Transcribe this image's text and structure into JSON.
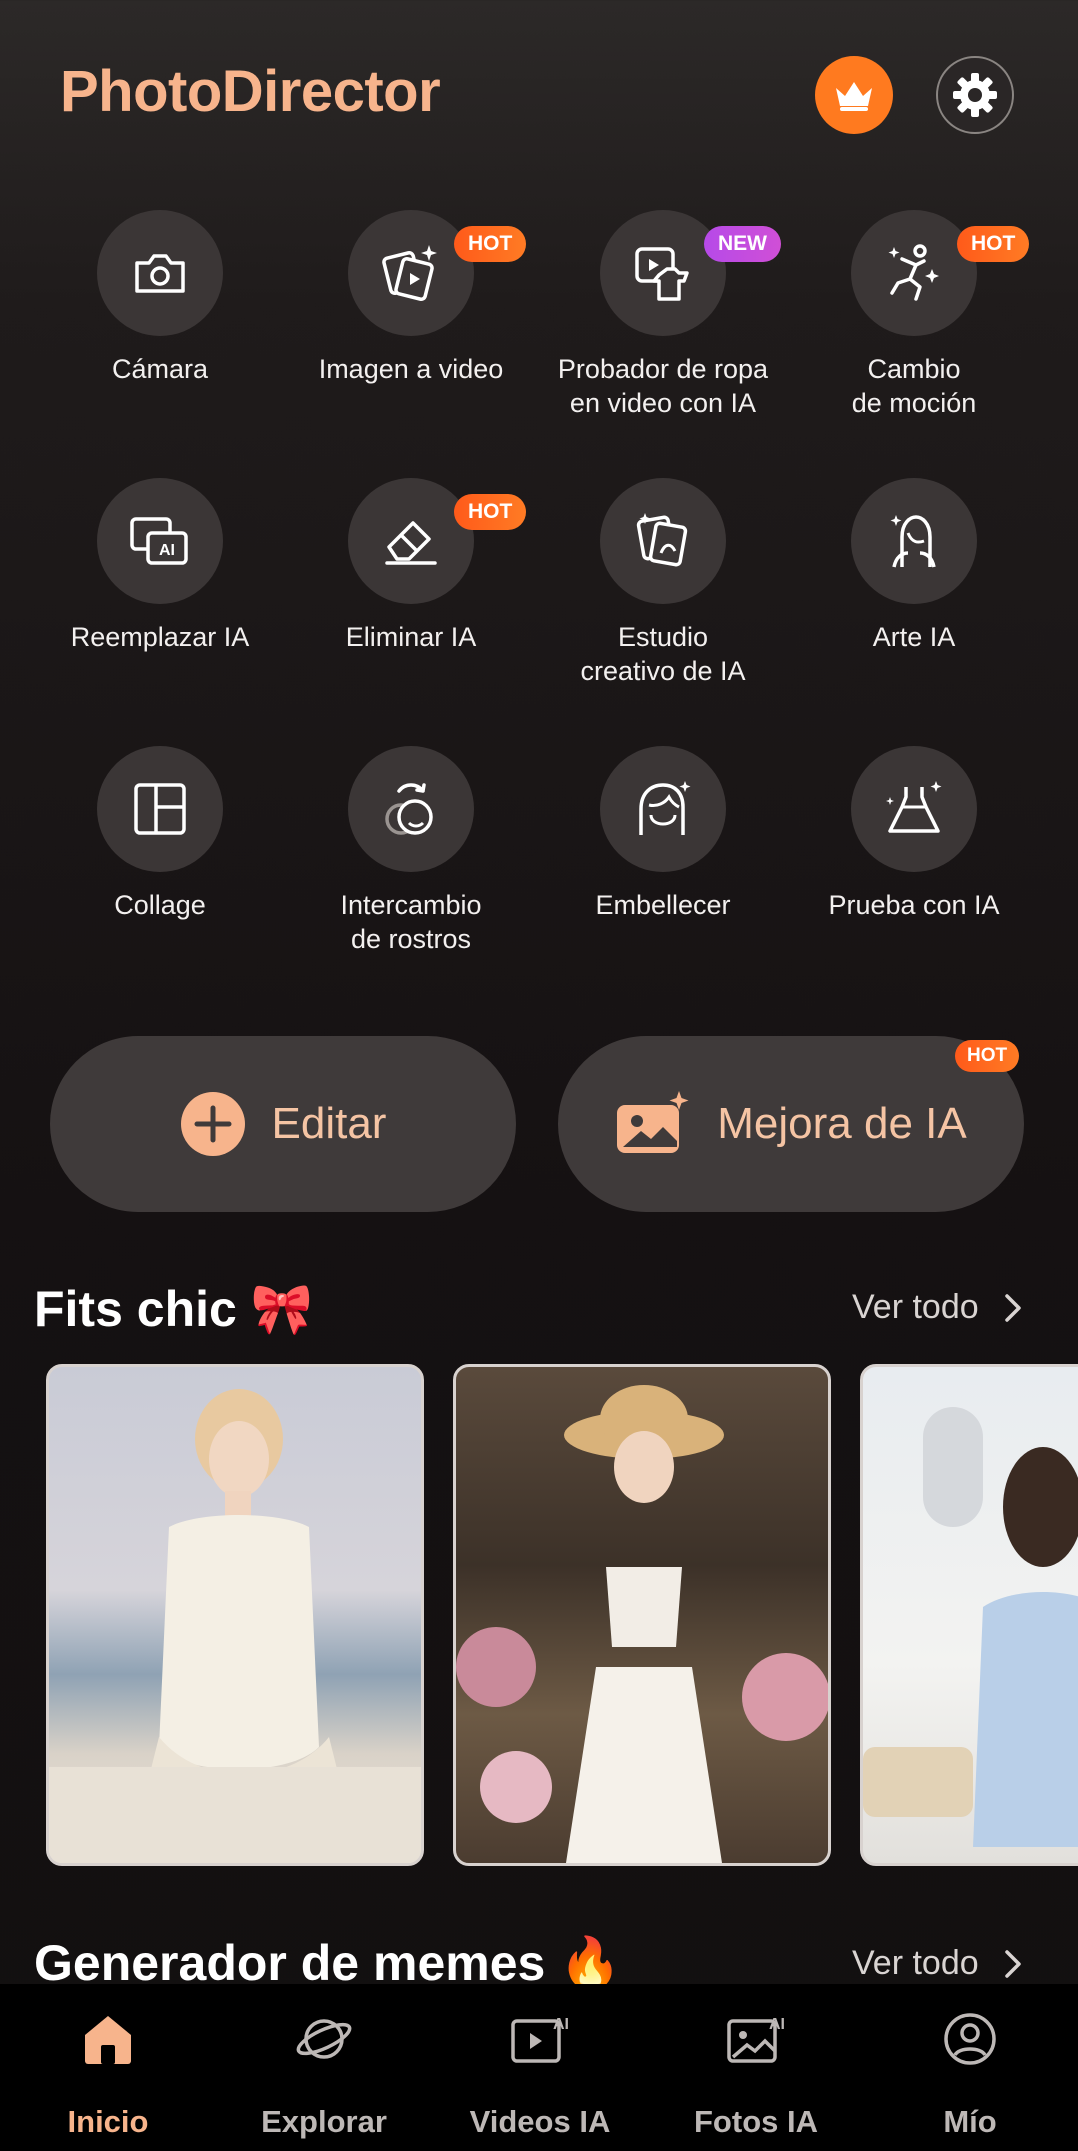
{
  "header": {
    "title": "PhotoDirector"
  },
  "tools": [
    {
      "label": "Cámara",
      "icon": "camera-icon",
      "badge": ""
    },
    {
      "label": "Imagen a video",
      "icon": "image-to-video-icon",
      "badge": "HOT"
    },
    {
      "label": "Probador de ropa\nen video con IA",
      "icon": "video-try-on-icon",
      "badge": "NEW"
    },
    {
      "label": "Cambio\nde moción",
      "icon": "motion-swap-icon",
      "badge": "HOT"
    },
    {
      "label": "Reemplazar IA",
      "icon": "ai-replace-icon",
      "badge": ""
    },
    {
      "label": "Eliminar IA",
      "icon": "eraser-icon",
      "badge": "HOT"
    },
    {
      "label": "Estudio\ncreativo de IA",
      "icon": "creative-studio-icon",
      "badge": ""
    },
    {
      "label": "Arte IA",
      "icon": "ai-art-icon",
      "badge": ""
    },
    {
      "label": "Collage",
      "icon": "collage-icon",
      "badge": ""
    },
    {
      "label": "Intercambio\nde rostros",
      "icon": "face-swap-icon",
      "badge": ""
    },
    {
      "label": "Embellecer",
      "icon": "beautify-icon",
      "badge": ""
    },
    {
      "label": "Prueba con IA",
      "icon": "dress-try-on-icon",
      "badge": ""
    }
  ],
  "actions": {
    "edit_label": "Editar",
    "enhance_label": "Mejora de IA",
    "enhance_badge": "HOT"
  },
  "sections": {
    "fits": {
      "title": "Fits chic 🎀",
      "see_all": "Ver todo"
    },
    "memes": {
      "title": "Generador de memes 🔥",
      "see_all": "Ver todo"
    }
  },
  "nav": {
    "items": [
      "Inicio",
      "Explorar",
      "Videos IA",
      "Fotos IA",
      "Mío"
    ],
    "active": "Inicio"
  },
  "colors": {
    "accent": "#f7b48c",
    "crown": "#ff7a1f",
    "hot": "#ff5a1a",
    "new": "#c04de0"
  }
}
